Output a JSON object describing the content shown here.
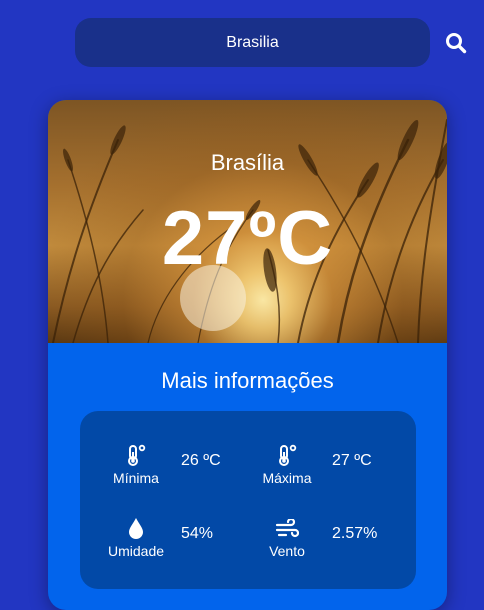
{
  "search": {
    "value": "Brasilia",
    "icon": "search-icon"
  },
  "weather": {
    "city": "Brasília",
    "temperature": "27ºC"
  },
  "details": {
    "title": "Mais informações",
    "items": [
      {
        "label": "Mínima",
        "value": "26 ºC",
        "icon": "thermometer-icon"
      },
      {
        "label": "Máxima",
        "value": "27 ºC",
        "icon": "thermometer-icon"
      },
      {
        "label": "Umidade",
        "value": "54%",
        "icon": "droplet-icon"
      },
      {
        "label": "Vento",
        "value": "2.57%",
        "icon": "wind-icon"
      }
    ]
  },
  "colors": {
    "background": "#2236c2",
    "search_bar": "#19308a",
    "card": "#0264ec",
    "info_box": "#0249a7"
  }
}
